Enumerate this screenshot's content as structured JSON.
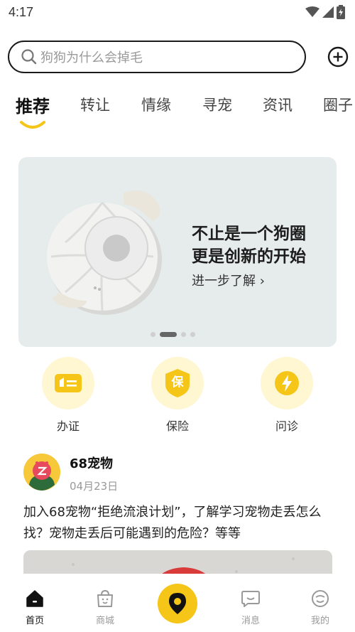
{
  "status_bar": {
    "time": "4:17"
  },
  "search": {
    "placeholder": "狗狗为什么会掉毛"
  },
  "tabs": [
    {
      "label": "推荐",
      "active": true
    },
    {
      "label": "转让"
    },
    {
      "label": "情缘"
    },
    {
      "label": "寻宠"
    },
    {
      "label": "资讯"
    },
    {
      "label": "圈子"
    }
  ],
  "banner": {
    "line1": "不止是一个狗圈",
    "line2": "更是创新的开始",
    "link": "进一步了解 ›",
    "slide_count": 4,
    "active_slide": 1
  },
  "quick_actions": [
    {
      "label": "办证",
      "icon": "id-card-icon"
    },
    {
      "label": "保险",
      "icon": "insurance-shield-icon",
      "glyph": "保"
    },
    {
      "label": "问诊",
      "icon": "lightning-consult-icon"
    }
  ],
  "post": {
    "author": "68宠物",
    "date": "04月23日",
    "text": "加入68宠物“拒绝流浪计划”，了解学习宠物走丢怎么找？宠物走丢后可能遇到的危险？等等"
  },
  "bottom_nav": [
    {
      "label": "首页",
      "icon": "home-icon",
      "active": true
    },
    {
      "label": "商城",
      "icon": "shop-bag-icon"
    },
    {
      "label": "",
      "icon": "location-pin-icon"
    },
    {
      "label": "消息",
      "icon": "message-icon"
    },
    {
      "label": "我的",
      "icon": "profile-face-icon"
    }
  ],
  "colors": {
    "accent": "#f5c518",
    "quick_bg": "#fff6d2",
    "banner_bg": "#e6ecec"
  }
}
